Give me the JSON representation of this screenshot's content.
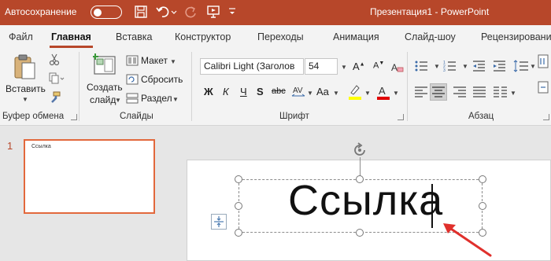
{
  "titlebar": {
    "autosave_label": "Автосохранение",
    "title": "Презентация1 - PowerPoint"
  },
  "tabs": [
    {
      "label": "Файл"
    },
    {
      "label": "Главная"
    },
    {
      "label": "Вставка"
    },
    {
      "label": "Конструктор"
    },
    {
      "label": "Переходы"
    },
    {
      "label": "Анимация"
    },
    {
      "label": "Слайд-шоу"
    },
    {
      "label": "Рецензирование"
    }
  ],
  "ribbon": {
    "clipboard": {
      "paste_label": "Вставить",
      "group_label": "Буфер обмена"
    },
    "slides": {
      "new_slide_line1": "Создать",
      "new_slide_line2": "слайд",
      "layout_label": "Макет",
      "reset_label": "Сбросить",
      "section_label": "Раздел",
      "group_label": "Слайды"
    },
    "font": {
      "font_name": "Calibri Light (Заголов",
      "font_size": "54",
      "bold": "Ж",
      "italic": "К",
      "underline": "Ч",
      "strike": "abc",
      "group_label": "Шрифт"
    },
    "paragraph": {
      "group_label": "Абзац"
    }
  },
  "thumbnails": [
    {
      "number": "1",
      "text": "Ссылка"
    }
  ],
  "slide": {
    "text": "Ссылка"
  },
  "colors": {
    "accent": "#b7472a",
    "thumb_border": "#e2683c",
    "arrow": "#e0302c",
    "highlight": "#ffff00",
    "font_color": "#e00000"
  }
}
